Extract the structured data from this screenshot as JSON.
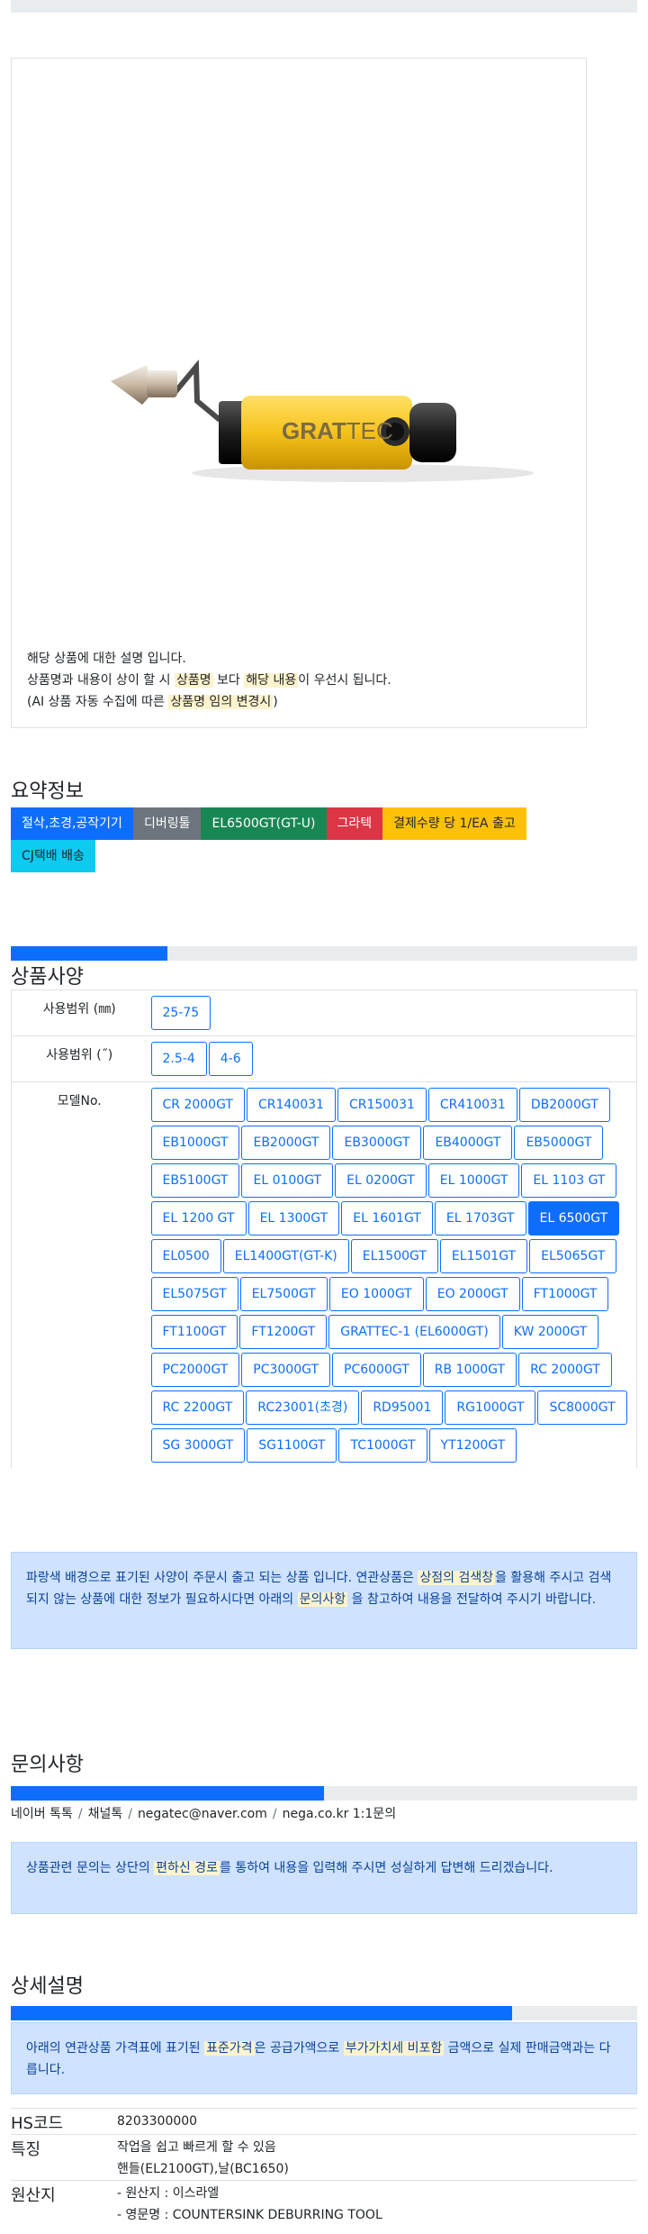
{
  "product": {
    "description": {
      "line1": "해당 상품에 대한 설명 입니다.",
      "line2_pre": "상품명과 내용이 상이 할 시 ",
      "line2_hl1": "상품명",
      "line2_mid": " 보다 ",
      "line2_hl2": "해당 내용",
      "line2_post": "이 우선시 됩니다.",
      "line3_pre": "(AI 상품 자동 수집에 따른 ",
      "line3_hl": "상품명 임의 변경시",
      "line3_post": ")"
    },
    "image": {
      "brand_text": "GRATTEC",
      "brand_bold": "GRAT",
      "brand_light": "TEC",
      "body_color": "#f5c21b"
    }
  },
  "summary": {
    "title": "요약정보",
    "badges": [
      {
        "label": "절삭,초경,공작기기",
        "color": "blue"
      },
      {
        "label": "디버링툴",
        "color": "gray"
      },
      {
        "label": "EL6500GT(GT-U)",
        "color": "green"
      },
      {
        "label": "그라텍",
        "color": "red"
      },
      {
        "label": "결제수량 당 1/EA 출고",
        "color": "yellow"
      },
      {
        "label": "CJ택배 배송",
        "color": "cyan"
      }
    ]
  },
  "specs": {
    "title": "상품사양",
    "progress_fraction": 0.25,
    "rows": [
      {
        "label": "사용범위 (㎜)",
        "options": [
          "25-75"
        ]
      },
      {
        "label": "사용범위 (˝)",
        "options": [
          "2.5-4",
          "4-6"
        ]
      },
      {
        "label": "모델No.",
        "options": [
          "CR 2000GT",
          "CR140031",
          "CR150031",
          "CR410031",
          "DB2000GT",
          "EB1000GT",
          "EB2000GT",
          "EB3000GT",
          "EB4000GT",
          "EB5000GT",
          "EB5100GT",
          "EL 0100GT",
          "EL 0200GT",
          "EL 1000GT",
          "EL 1103 GT",
          "EL 1200 GT",
          "EL 1300GT",
          "EL 1601GT",
          "EL 1703GT",
          "EL 6500GT",
          "EL0500",
          "EL1400GT(GT-K)",
          "EL1500GT",
          "EL1501GT",
          "EL5065GT",
          "EL5075GT",
          "EL7500GT",
          "EO 1000GT",
          "EO 2000GT",
          "FT1000GT",
          "FT1100GT",
          "FT1200GT",
          "GRATTEC-1 (EL6000GT)",
          "KW 2000GT",
          "PC2000GT",
          "PC3000GT",
          "PC6000GT",
          "RB 1000GT",
          "RC 2000GT",
          "RC 2200GT",
          "RC23001(초경)",
          "RD95001",
          "RG1000GT",
          "SC8000GT",
          "SG 3000GT",
          "SG1100GT",
          "TC1000GT",
          "YT1200GT"
        ],
        "selected": "EL 6500GT"
      }
    ],
    "notice": {
      "pre": "파랑색 배경으로 표기된 사양이 주문시 출고 되는 상품 입니다. 연관상품은 ",
      "hl1": "상점의 검색창",
      "mid": "을 활용해 주시고 검색되지 않는 상품에 대한 정보가 필요하시다면 아래의 ",
      "hl2": "문의사항",
      "post": " 을 참고하여 내용을 전달하여 주시기 바랍니다."
    }
  },
  "inquiry": {
    "title": "문의사항",
    "progress_fraction": 0.5,
    "channels": [
      "네이버 톡톡",
      "채널톡",
      "negatec@naver.com",
      "nega.co.kr 1:1문의"
    ],
    "notice": {
      "pre": "상품관련 문의는 상단의 ",
      "hl": "편하신 경로",
      "post": "를 통하여 내용을 입력해 주시면 성실하게 답변해 드리겠습니다."
    }
  },
  "detail": {
    "title": "상세설명",
    "progress_fraction": 0.8,
    "notice": {
      "pre": "아래의 연관상품 가격표에 표기된 ",
      "hl1": "표준가격",
      "mid": "은 공급가액으로 ",
      "hl2": "부가가치세 비포함",
      "post": " 금액으로 실제 판매금액과는 다릅니다."
    },
    "info": [
      {
        "key": "HS코드",
        "lines": [
          "8203300000"
        ]
      },
      {
        "key": "특징",
        "lines": [
          "작업을 쉽고 빠르게 할 수 있음",
          "핸들(EL2100GT),날(BC1650)"
        ]
      },
      {
        "key": "원산지",
        "lines": [
          "- 원산지 : 이스라엘",
          "- 영문명 : COUNTERSINK DEBURRING TOOL"
        ]
      }
    ]
  }
}
